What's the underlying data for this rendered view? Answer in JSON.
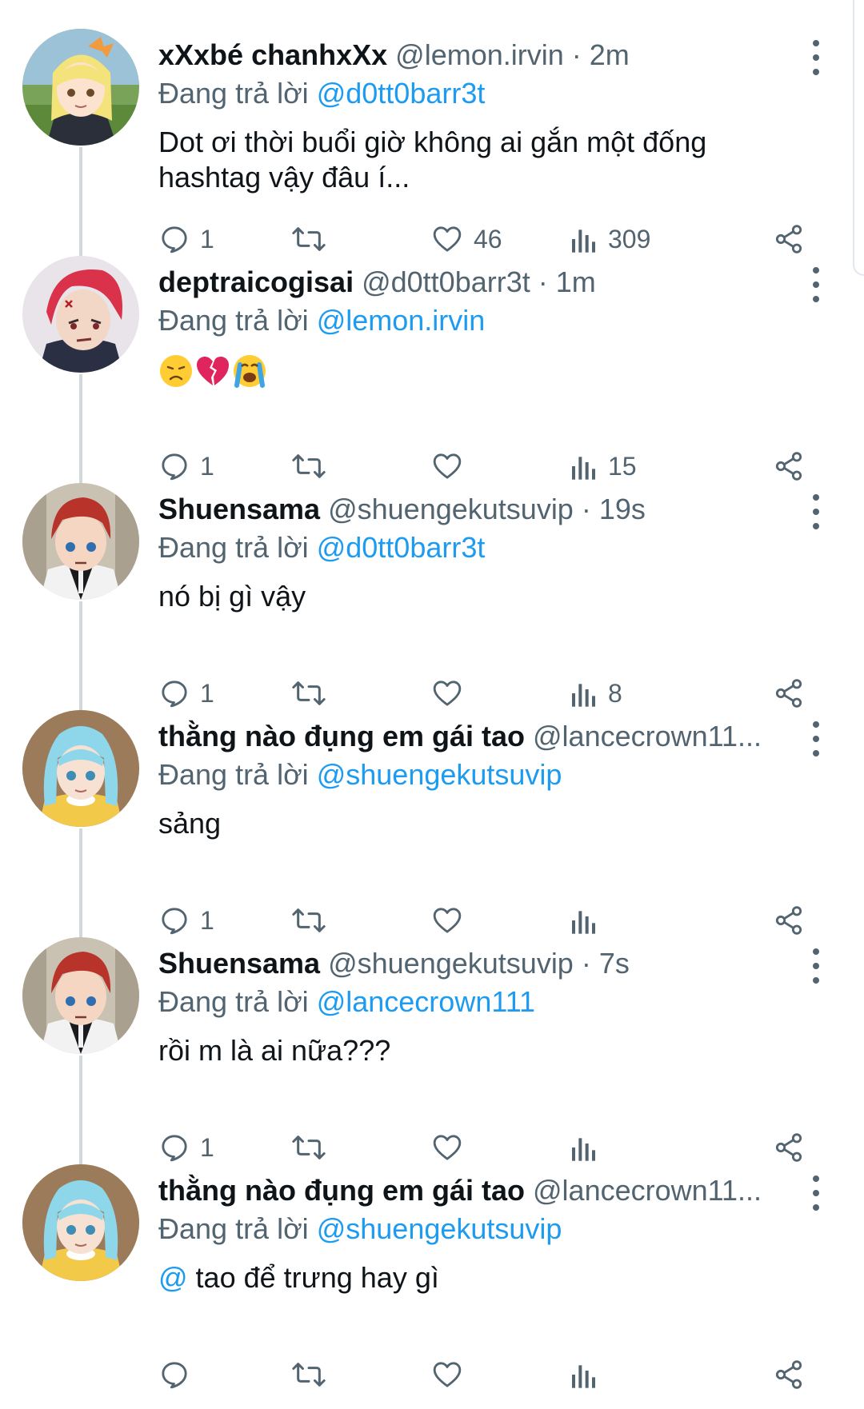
{
  "labels": {
    "replying_to": "Đang trả lời"
  },
  "colors": {
    "text_primary": "#0f1419",
    "text_secondary": "#536471",
    "accent": "#1d9bf0",
    "thread_line": "#cfd9de"
  },
  "tweets": [
    {
      "display_name": "xXxbé chanhxXx",
      "handle_meta": "@lemon.irvin · 2m",
      "reply_to": "@d0tt0barr3t",
      "text": "Dot ơi thời buổi giờ không ai gắn một đống hashtag vậy đâu í...",
      "avatar": "blonde-anime-girl-avatar",
      "replies": "1",
      "retweets": "",
      "likes": "46",
      "views": "309"
    },
    {
      "display_name": "deptraicogisai",
      "handle_meta": "@d0tt0barr3t · 1m",
      "reply_to": "@lemon.irvin",
      "text": "",
      "emojis": [
        "disappointed-face-emoji",
        "broken-heart-emoji",
        "loudly-crying-face-emoji"
      ],
      "avatar": "red-hair-anime-boy-avatar",
      "replies": "1",
      "retweets": "",
      "likes": "",
      "views": "15"
    },
    {
      "display_name": "Shuensama",
      "handle_meta": "@shuengekutsuvip · 19s",
      "reply_to": "@d0tt0barr3t",
      "text": "nó bị gì vậy",
      "avatar": "auburn-hair-anime-boy-avatar",
      "replies": "1",
      "retweets": "",
      "likes": "",
      "views": "8"
    },
    {
      "display_name": "thằng nào đụng em gái tao",
      "handle_meta": "@lancecrown11...",
      "reply_to": "@shuengekutsuvip",
      "text": "sảng",
      "avatar": "blue-hair-anime-girl-avatar",
      "replies": "1",
      "retweets": "",
      "likes": "",
      "views": ""
    },
    {
      "display_name": "Shuensama",
      "handle_meta": "@shuengekutsuvip · 7s",
      "reply_to": "@lancecrown111",
      "text": "rồi m là ai nữa???",
      "avatar": "auburn-hair-anime-boy-avatar",
      "replies": "1",
      "retweets": "",
      "likes": "",
      "views": ""
    },
    {
      "display_name": "thằng nào đụng em gái tao",
      "handle_meta": "@lancecrown11...",
      "reply_to": "@shuengekutsuvip",
      "text_prefix": "@",
      "text": " tao để trưng hay gì",
      "avatar": "blue-hair-anime-girl-avatar",
      "replies": "",
      "retweets": "",
      "likes": "",
      "views": ""
    }
  ]
}
